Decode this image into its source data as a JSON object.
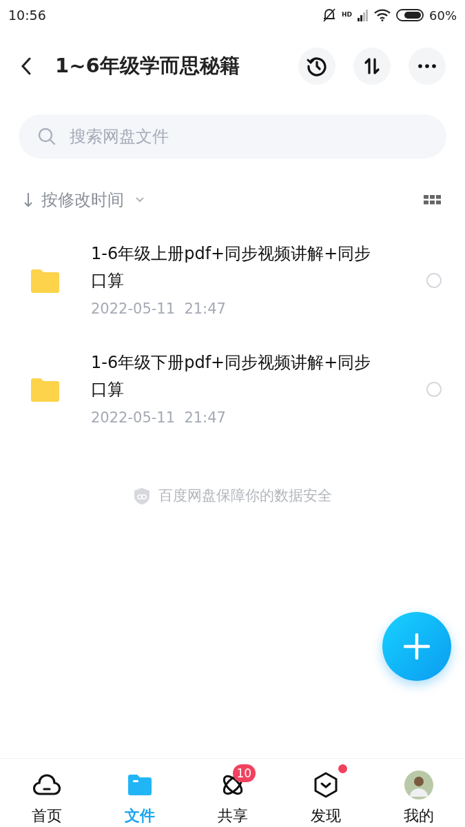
{
  "status_bar": {
    "time": "10:56",
    "network": "HD",
    "battery": "60%"
  },
  "header": {
    "title": "1~6年级学而思秘籍"
  },
  "search": {
    "placeholder": "搜索网盘文件"
  },
  "sort": {
    "label": "按修改时间"
  },
  "files": [
    {
      "name": "1-6年级上册pdf+同步视频讲解+同步口算",
      "date": "2022-05-11",
      "time": "21:47",
      "selected": false
    },
    {
      "name": "1-6年级下册pdf+同步视频讲解+同步口算",
      "date": "2022-05-11",
      "time": "21:47",
      "selected": false
    }
  ],
  "footer_note": "百度网盘保障你的数据安全",
  "tabs": [
    {
      "label": "首页",
      "kind": "home",
      "selected": false
    },
    {
      "label": "文件",
      "kind": "files",
      "selected": true
    },
    {
      "label": "共享",
      "kind": "share",
      "selected": false,
      "badge": "10"
    },
    {
      "label": "发现",
      "kind": "discover",
      "selected": false,
      "dot": true
    },
    {
      "label": "我的",
      "kind": "me",
      "selected": false
    }
  ]
}
